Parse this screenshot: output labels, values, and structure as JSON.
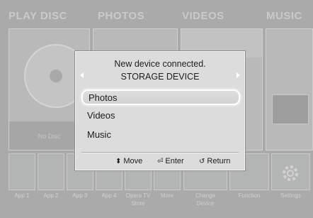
{
  "sections": [
    "PLAY DISC",
    "PHOTOS",
    "VIDEOS",
    "MUSIC"
  ],
  "disc_label": "No Disc",
  "apps": [
    {
      "label": "App 1"
    },
    {
      "label": "App 2"
    },
    {
      "label": "App 3"
    },
    {
      "label": "App 4"
    },
    {
      "label": "Opera TV Store"
    },
    {
      "label": "More"
    },
    {
      "label": "Change Device"
    },
    {
      "label": "Function"
    },
    {
      "label": "Settings"
    }
  ],
  "dialog": {
    "title_line1": "New device connected.",
    "title_line2": "STORAGE DEVICE",
    "items": [
      "Photos",
      "Videos",
      "Music"
    ],
    "selected_index": 0,
    "hints": {
      "move": "Move",
      "enter": "Enter",
      "return": "Return"
    }
  },
  "colors": {
    "background": "#a9aaa9",
    "dialog_bg": "#dcdcdc",
    "highlight": "#ffffff"
  }
}
